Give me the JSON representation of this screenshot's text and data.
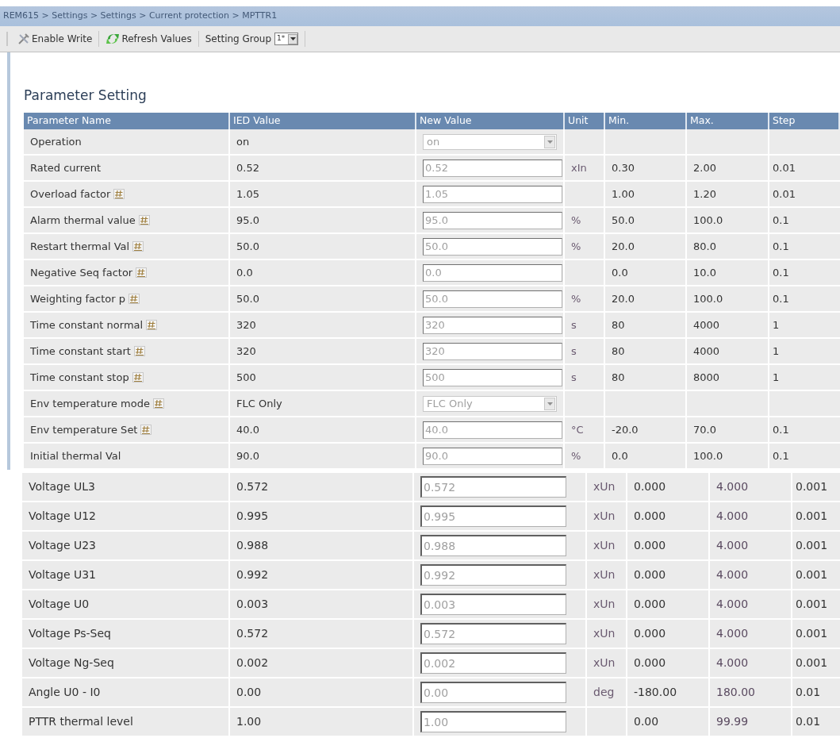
{
  "breadcrumb": "REM615 > Settings > Settings > Current protection > MPTTR1",
  "toolbar": {
    "buttons": [
      {
        "label": "Enable Write",
        "kind": "write"
      },
      {
        "label": "Refresh Values",
        "kind": "refresh"
      }
    ],
    "setting_group": {
      "label": "Setting Group",
      "value": "1*"
    }
  },
  "title": "Parameter Setting",
  "table": {
    "columns": [
      "Parameter Name",
      "IED Value",
      "New Value",
      "Unit",
      "Min.",
      "Max.",
      "Step"
    ],
    "rows": [
      {
        "name": "Operation",
        "flag": false,
        "ied_value": "on",
        "new_value": {
          "kind": "select",
          "value": "on"
        }
      },
      {
        "name": "Rated current",
        "flag": false,
        "ied_value": "0.52",
        "new_value": {
          "kind": "text",
          "value": "0.52"
        },
        "unit": "xIn",
        "min": "0.30",
        "max": "2.00",
        "step": "0.01"
      },
      {
        "name": "Overload factor",
        "flag": true,
        "ied_value": "1.05",
        "new_value": {
          "kind": "text",
          "value": "1.05"
        },
        "min": "1.00",
        "max": "1.20",
        "step": "0.01"
      },
      {
        "name": "Alarm thermal value",
        "flag": true,
        "ied_value": "95.0",
        "new_value": {
          "kind": "text",
          "value": "95.0"
        },
        "unit": "%",
        "min": "50.0",
        "max": "100.0",
        "step": "0.1"
      },
      {
        "name": "Restart thermal Val",
        "flag": true,
        "ied_value": "50.0",
        "new_value": {
          "kind": "text",
          "value": "50.0"
        },
        "unit": "%",
        "min": "20.0",
        "max": "80.0",
        "step": "0.1"
      },
      {
        "name": "Negative Seq factor",
        "flag": true,
        "ied_value": "0.0",
        "new_value": {
          "kind": "text",
          "value": "0.0"
        },
        "min": "0.0",
        "max": "10.0",
        "step": "0.1"
      },
      {
        "name": "Weighting factor p",
        "flag": true,
        "ied_value": "50.0",
        "new_value": {
          "kind": "text",
          "value": "50.0"
        },
        "unit": "%",
        "min": "20.0",
        "max": "100.0",
        "step": "0.1"
      },
      {
        "name": "Time constant normal",
        "flag": true,
        "ied_value": "320",
        "new_value": {
          "kind": "text",
          "value": "320"
        },
        "unit": "s",
        "min": "80",
        "max": "4000",
        "step": "1"
      },
      {
        "name": "Time constant start",
        "flag": true,
        "ied_value": "320",
        "new_value": {
          "kind": "text",
          "value": "320"
        },
        "unit": "s",
        "min": "80",
        "max": "4000",
        "step": "1"
      },
      {
        "name": "Time constant stop",
        "flag": true,
        "ied_value": "500",
        "new_value": {
          "kind": "text",
          "value": "500"
        },
        "unit": "s",
        "min": "80",
        "max": "8000",
        "step": "1"
      },
      {
        "name": "Env temperature mode",
        "flag": true,
        "ied_value": "FLC Only",
        "new_value": {
          "kind": "select",
          "value": "FLC Only"
        }
      },
      {
        "name": "Env temperature Set",
        "flag": true,
        "ied_value": "40.0",
        "new_value": {
          "kind": "text",
          "value": "40.0"
        },
        "unit": "°C",
        "min": "-20.0",
        "max": "70.0",
        "step": "0.1"
      },
      {
        "name": "Initial thermal Val",
        "flag": false,
        "ied_value": "90.0",
        "new_value": {
          "kind": "text",
          "value": "90.0"
        },
        "unit": "%",
        "min": "0.0",
        "max": "100.0",
        "step": "0.1"
      }
    ]
  },
  "table_2": {
    "rows": [
      {
        "name": "Voltage UL3",
        "ied_value": "0.572",
        "new_value": "0.572",
        "unit": "xUn",
        "min": "0.000",
        "max": "4.000",
        "step": "0.001"
      },
      {
        "name": "Voltage U12",
        "ied_value": "0.995",
        "new_value": "0.995",
        "unit": "xUn",
        "min": "0.000",
        "max": "4.000",
        "step": "0.001"
      },
      {
        "name": "Voltage U23",
        "ied_value": "0.988",
        "new_value": "0.988",
        "unit": "xUn",
        "min": "0.000",
        "max": "4.000",
        "step": "0.001"
      },
      {
        "name": "Voltage U31",
        "ied_value": "0.992",
        "new_value": "0.992",
        "unit": "xUn",
        "min": "0.000",
        "max": "4.000",
        "step": "0.001"
      },
      {
        "name": "Voltage U0",
        "ied_value": "0.003",
        "new_value": "0.003",
        "unit": "xUn",
        "min": "0.000",
        "max": "4.000",
        "step": "0.001"
      },
      {
        "name": "Voltage Ps-Seq",
        "ied_value": "0.572",
        "new_value": "0.572",
        "unit": "xUn",
        "min": "0.000",
        "max": "4.000",
        "step": "0.001"
      },
      {
        "name": "Voltage Ng-Seq",
        "ied_value": "0.002",
        "new_value": "0.002",
        "unit": "xUn",
        "min": "0.000",
        "max": "4.000",
        "step": "0.001"
      },
      {
        "name": "Angle U0 - I0",
        "ied_value": "0.00",
        "new_value": "0.00",
        "unit": "deg",
        "min": "-180.00",
        "max": "180.00",
        "step": "0.01"
      },
      {
        "name": "PTTR thermal level",
        "ied_value": "1.00",
        "new_value": "1.00",
        "min": "0.00",
        "max": "99.99",
        "step": "0.01"
      }
    ]
  }
}
